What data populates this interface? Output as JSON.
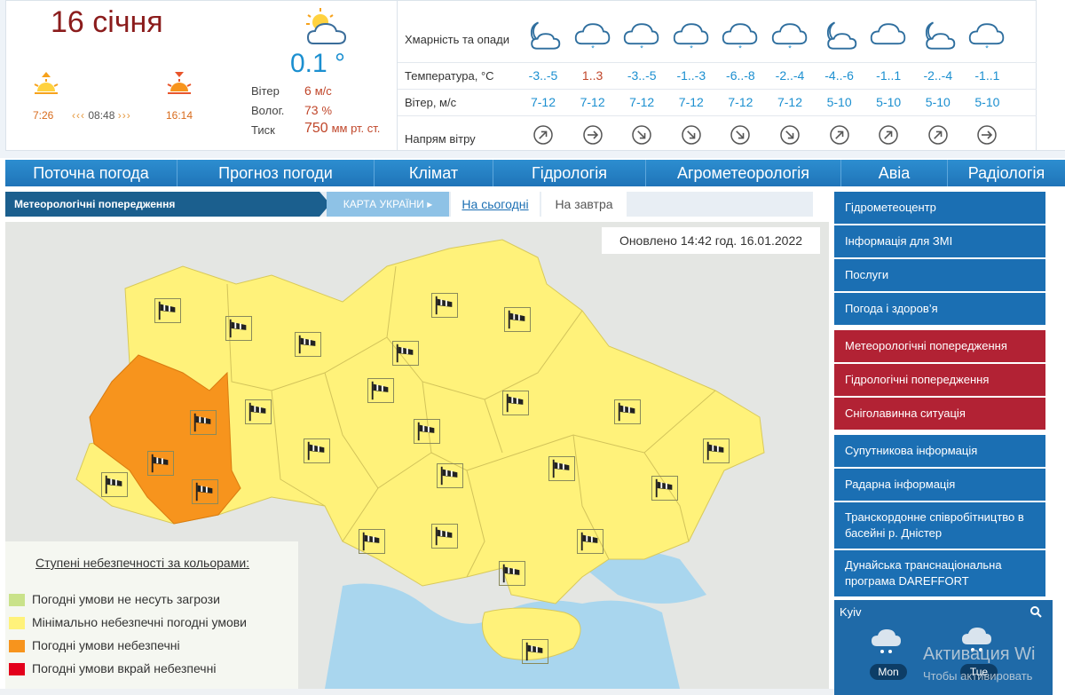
{
  "current": {
    "date": "16 січня",
    "temperature": "0.1 °",
    "sunrise": "7:26",
    "day_length": "08:48",
    "sunset": "16:14",
    "wind_label": "Вітер",
    "wind_value": "6",
    "wind_unit": "м/с",
    "humidity_label": "Волог.",
    "humidity_value": "73",
    "humidity_unit": "%",
    "pressure_label": "Тиск",
    "pressure_value": "750",
    "pressure_unit": "мм рт. ст."
  },
  "forecast": {
    "row_labels": {
      "clouds": "Хмарність та опади",
      "temperature": "Температура, °С",
      "wind": "Вітер, м/с",
      "wind_dir": "Напрям вітру"
    },
    "columns": [
      {
        "icon": "moon-cloud-icon",
        "temp": "-3..-5",
        "wind": "7-12",
        "dir": "ne"
      },
      {
        "icon": "snow-cloud-icon",
        "temp": "1..3",
        "wind": "7-12",
        "dir": "e"
      },
      {
        "icon": "snow-cloud-icon",
        "temp": "-3..-5",
        "wind": "7-12",
        "dir": "se"
      },
      {
        "icon": "snow-cloud-icon",
        "temp": "-1..-3",
        "wind": "7-12",
        "dir": "se"
      },
      {
        "icon": "snow-cloud-icon",
        "temp": "-6..-8",
        "wind": "7-12",
        "dir": "se"
      },
      {
        "icon": "snow-cloud-icon",
        "temp": "-2..-4",
        "wind": "7-12",
        "dir": "se"
      },
      {
        "icon": "moon-cloud-icon",
        "temp": "-4..-6",
        "wind": "5-10",
        "dir": "ne"
      },
      {
        "icon": "cloud-icon",
        "temp": "-1..1",
        "wind": "5-10",
        "dir": "ne"
      },
      {
        "icon": "moon-cloud-icon",
        "temp": "-2..-4",
        "wind": "5-10",
        "dir": "ne"
      },
      {
        "icon": "snow-cloud-icon",
        "temp": "-1..1",
        "wind": "5-10",
        "dir": "e"
      }
    ]
  },
  "main_nav": [
    "Поточна погода",
    "Прогноз погоди",
    "Клімат",
    "Гідрологія",
    "Агрометеорологія",
    "Авіа",
    "Радіологія"
  ],
  "sub_nav": {
    "warnings": "Метеорологічні попередження",
    "map": "КАРТА УКРАЇНИ ▸",
    "today": "На сьогодні",
    "tomorrow": "На завтра"
  },
  "map": {
    "updated": "Оновлено 14:42 год. 16.01.2022",
    "warning_icon": "windsock-icon"
  },
  "legend": {
    "title": "Ступені небезпечності за кольорами:",
    "items": [
      {
        "label": "Погодні умови не несуть загрози",
        "color": "#c9e28a"
      },
      {
        "label": "Мінімально небезпечні погодні умови",
        "color": "#fff27a"
      },
      {
        "label": "Погодні умови небезпечні",
        "color": "#f7941d"
      },
      {
        "label": "Погодні умови вкрай небезпечні",
        "color": "#e3001b"
      }
    ]
  },
  "sidebar": [
    {
      "label": "Гідрометеоцентр",
      "style": "blue"
    },
    {
      "label": "Інформація для ЗМІ",
      "style": "blue"
    },
    {
      "label": "Послуги",
      "style": "blue"
    },
    {
      "label": "Погода і здоров’я",
      "style": "blue"
    },
    {
      "label": "Метеорологічні попередження",
      "style": "red"
    },
    {
      "label": "Гідрологічні попередження",
      "style": "red"
    },
    {
      "label": "Сніголавинна ситуація",
      "style": "red"
    },
    {
      "label": "Супутникова інформація",
      "style": "blue"
    },
    {
      "label": "Радарна інформація",
      "style": "blue"
    },
    {
      "label": "Транскордонне співробітництво в басейні р. Дністер",
      "style": "blue"
    },
    {
      "label": "Дунайська транснаціональна програма DAREFFORT",
      "style": "blue"
    }
  ],
  "kyiv": {
    "title": "Kyiv",
    "day1": "Mon",
    "day2": "Tue"
  },
  "watermark": {
    "line1": "Активация Wi",
    "line2": "Чтобы активировать"
  },
  "colors": {
    "accent": "#1b6fb3",
    "danger_sidebar": "#b22234",
    "region_yellow": "#fff27a",
    "region_orange": "#f7941d",
    "water": "#a9d6ee"
  }
}
